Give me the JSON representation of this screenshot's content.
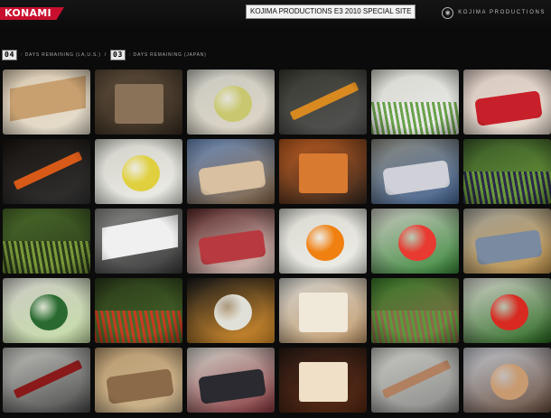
{
  "header": {
    "brand": "KONAMI",
    "site_title": "KOJIMA PRODUCTIONS E3 2010 SPECIAL SITE",
    "studio": "KOJIMA PRODUCTIONS"
  },
  "countdown": {
    "us_days": "04",
    "us_label": ": DAYS REMAINING (LA,U.S.)",
    "separator": "/",
    "jp_days": "03",
    "jp_label": ": DAYS REMAINING (JAPAN)"
  },
  "tiles": [
    {
      "name": "cut-bread-tile",
      "bg": "#d9c9b0",
      "c1": "#c8a070",
      "c2": "#e8e0d0",
      "kind": "slice"
    },
    {
      "name": "wooden-drawer-tile",
      "bg": "#5a4a38",
      "c1": "#8a7258",
      "c2": "#3a2e22",
      "kind": "box"
    },
    {
      "name": "melon-tile",
      "bg": "#c8c8c0",
      "c1": "#c9c870",
      "c2": "#e0d8c8",
      "kind": "ball"
    },
    {
      "name": "chainsaw-tile",
      "bg": "#3a3a32",
      "c1": "#d88a20",
      "c2": "#555",
      "kind": "blade"
    },
    {
      "name": "green-sprouts-tile",
      "bg": "#d8d8d0",
      "c1": "#6aa24a",
      "c2": "#eaeaea",
      "kind": "grass"
    },
    {
      "name": "red-tuna-tile",
      "bg": "#d8c8c0",
      "c1": "#c8202a",
      "c2": "#e8dcd0",
      "kind": "slab"
    },
    {
      "name": "pliers-tile",
      "bg": "#1a1410",
      "c1": "#d85a18",
      "c2": "#333",
      "kind": "blade"
    },
    {
      "name": "lemon-tile",
      "bg": "#d0d0c8",
      "c1": "#e0d040",
      "c2": "#f0f0ea",
      "kind": "ball"
    },
    {
      "name": "chicken-carving-tile",
      "bg": "#6a8ab8",
      "c1": "#d8c0a0",
      "c2": "#8a6a48",
      "kind": "slab"
    },
    {
      "name": "band-saw-tile",
      "bg": "#b85a20",
      "c1": "#d87a30",
      "c2": "#3a2a20",
      "kind": "box"
    },
    {
      "name": "fish-cleaning-tile",
      "bg": "#8a8a80",
      "c1": "#d0d0d8",
      "c2": "#4a6a9a",
      "kind": "slab"
    },
    {
      "name": "grape-vines-tile",
      "bg": "#3a5a28",
      "c1": "#2a2a4a",
      "c2": "#6a9a3a",
      "kind": "grass"
    },
    {
      "name": "bamboo-forest-tile",
      "bg": "#4a6a2a",
      "c1": "#7a9a3a",
      "c2": "#2a3a1a",
      "kind": "grass"
    },
    {
      "name": "paper-cut-tile",
      "bg": "#8a8a88",
      "c1": "#f0f0f0",
      "c2": "#3a3a3a",
      "kind": "slice"
    },
    {
      "name": "raw-beef-tile",
      "bg": "#5a2a2a",
      "c1": "#b83a40",
      "c2": "#e8d0c8",
      "kind": "slab"
    },
    {
      "name": "orange-tile",
      "bg": "#d8d8d0",
      "c1": "#f08010",
      "c2": "#f0f0ea",
      "kind": "ball"
    },
    {
      "name": "watermelon-tile",
      "bg": "#c8c8c0",
      "c1": "#e83a30",
      "c2": "#3a8a3a",
      "kind": "ball"
    },
    {
      "name": "salmon-board-tile",
      "bg": "#a0a098",
      "c1": "#7a8aa0",
      "c2": "#c89a50",
      "kind": "slab"
    },
    {
      "name": "cucumber-tile",
      "bg": "#cacac4",
      "c1": "#2a6a30",
      "c2": "#c8e0a8",
      "kind": "ball"
    },
    {
      "name": "lumberjack-tile",
      "bg": "#2a3a1a",
      "c1": "#c83a20",
      "c2": "#4a6a2a",
      "kind": "grass"
    },
    {
      "name": "knife-diagram-tile",
      "bg": "#1a1a1a",
      "c1": "#e0e0d8",
      "c2": "#e89a30",
      "kind": "ball"
    },
    {
      "name": "bread-loaf-tile",
      "bg": "#d0d0cc",
      "c1": "#f0e8d8",
      "c2": "#c8a070",
      "kind": "box"
    },
    {
      "name": "lawn-tile",
      "bg": "#3a7a2a",
      "c1": "#5a9a3a",
      "c2": "#8a6a4a",
      "kind": "grass"
    },
    {
      "name": "tomato-tile",
      "bg": "#d0d0c8",
      "c1": "#d82a20",
      "c2": "#2a6a20",
      "kind": "ball"
    },
    {
      "name": "can-opener-tile",
      "bg": "#c0c0bc",
      "c1": "#8a1a1a",
      "c2": "#4a4a4a",
      "kind": "blade"
    },
    {
      "name": "wood-plank-tile",
      "bg": "#b89a70",
      "c1": "#8a6a48",
      "c2": "#d0b890",
      "kind": "slab"
    },
    {
      "name": "tuna-head-tile",
      "bg": "#d0d0c8",
      "c1": "#2a2a30",
      "c2": "#8a3a40",
      "kind": "slab"
    },
    {
      "name": "cake-tile",
      "bg": "#2a1a14",
      "c1": "#f0e0c8",
      "c2": "#5a2a14",
      "kind": "box"
    },
    {
      "name": "hand-knife-tile",
      "bg": "#c8c8c4",
      "c1": "#b08060",
      "c2": "#8a8a88",
      "kind": "blade"
    },
    {
      "name": "haircut-tile",
      "bg": "#c0c4cc",
      "c1": "#c89a70",
      "c2": "#6a5040",
      "kind": "ball"
    }
  ]
}
